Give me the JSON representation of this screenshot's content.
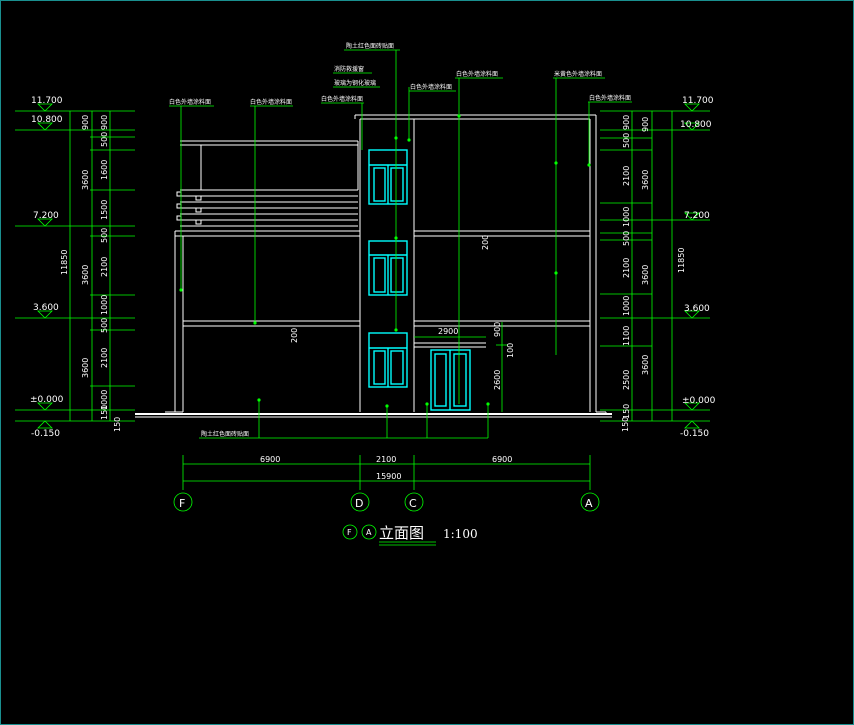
{
  "levels_left": [
    "11.700",
    "10.800",
    "7.200",
    "3.600",
    "±0.000",
    "-0.150"
  ],
  "levels_right": [
    "11.700",
    "10.800",
    "7.200",
    "3.600",
    "±0.000",
    "-0.150"
  ],
  "dims_left_inner": [
    "900",
    "500",
    "1600",
    "1500",
    "500",
    "2100",
    "1000",
    "500",
    "2100",
    "1000",
    "150"
  ],
  "dims_left_outer": [
    "900",
    "3600",
    "3600",
    "3600",
    "150"
  ],
  "dim_left_total": "11850",
  "dims_right_inner": [
    "900",
    "500",
    "2100",
    "1000",
    "500",
    "2100",
    "1000",
    "1100",
    "2500",
    "150"
  ],
  "dims_right_outer": [
    "900",
    "3600",
    "3600",
    "3600",
    "150"
  ],
  "dim_right_total": "11850",
  "dims_bottom": [
    "6900",
    "2100",
    "6900"
  ],
  "dim_bottom_total": "15900",
  "axes": [
    "F",
    "D",
    "C",
    "A"
  ],
  "inner_dims": {
    "canopy_width": "2900",
    "canopy_h1": "900",
    "canopy_h2": "100",
    "door_h": "2600",
    "mid_200_a": "200",
    "mid_200_b": "200"
  },
  "labels": {
    "top_center": "陶土红色面砖贴面",
    "glass_1": "消防救援窗",
    "glass_2": "玻璃为钢化玻璃",
    "wall_white_a": "白色外墙涂料面",
    "wall_white_b": "白色外墙涂料面",
    "wall_white_c": "白色外墙涂料面",
    "wall_white_d": "白色外墙涂料面",
    "wall_white_e": "白色外墙涂料面",
    "wall_beige": "米黄色外墙涂料面",
    "wall_white_f": "白色外墙涂料面",
    "base": "陶土红色面砖贴面"
  },
  "title": {
    "axis_from": "F",
    "axis_to": "A",
    "text": "立面图",
    "scale": "1:100"
  }
}
